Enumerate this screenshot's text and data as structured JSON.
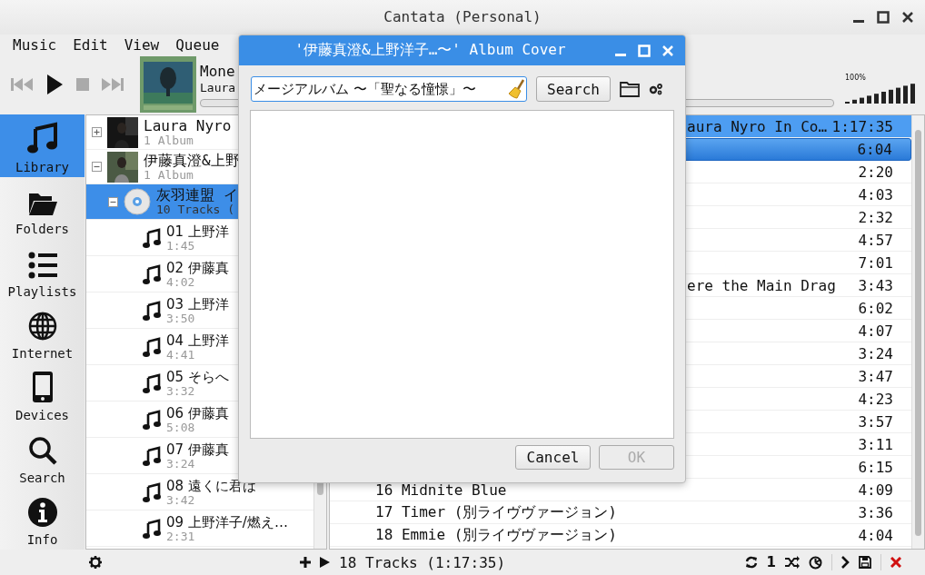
{
  "window": {
    "title": "Cantata (Personal)"
  },
  "menu": [
    "Music",
    "Edit",
    "View",
    "Queue"
  ],
  "now_playing": {
    "title": "Mone",
    "artist": "Laura",
    "volume": "100%"
  },
  "sidebar": [
    {
      "label": "Library",
      "selected": true,
      "kind": "library"
    },
    {
      "label": "Folders",
      "selected": false,
      "kind": "folders"
    },
    {
      "label": "Playlists",
      "selected": false,
      "kind": "playlists"
    },
    {
      "label": "Internet",
      "selected": false,
      "kind": "internet"
    },
    {
      "label": "Devices",
      "selected": false,
      "kind": "devices"
    },
    {
      "label": "Search",
      "selected": false,
      "kind": "search"
    },
    {
      "label": "Info",
      "selected": false,
      "kind": "info"
    }
  ],
  "library": {
    "items": [
      {
        "kind": "artist",
        "name": "Laura Nyro",
        "subtitle": "1 Album",
        "expanded": false,
        "selected": false
      },
      {
        "kind": "artist",
        "name": "伊藤真澄&上野",
        "subtitle": "1 Album",
        "expanded": true,
        "selected": false,
        "children": [
          {
            "kind": "album",
            "name": "灰羽連盟 イ",
            "subtitle": "10 Tracks (",
            "expanded": true,
            "selected": true,
            "children": [
              {
                "kind": "track",
                "name": "01 上野洋",
                "subtitle": "1:45",
                "selected": false
              },
              {
                "kind": "track",
                "name": "02 伊藤真",
                "subtitle": "4:02",
                "selected": false
              },
              {
                "kind": "track",
                "name": "03 上野洋",
                "subtitle": "3:50",
                "selected": false
              },
              {
                "kind": "track",
                "name": "04 上野洋",
                "subtitle": "4:41",
                "selected": false
              },
              {
                "kind": "track",
                "name": "05 そらへ",
                "subtitle": "3:32",
                "selected": false
              },
              {
                "kind": "track",
                "name": "06 伊藤真",
                "subtitle": "5:08",
                "selected": false
              },
              {
                "kind": "track",
                "name": "07 伊藤真",
                "subtitle": "3:24",
                "selected": false
              },
              {
                "kind": "track",
                "name": "08 遠くに君は",
                "subtitle": "3:42",
                "selected": false
              },
              {
                "kind": "track",
                "name": "09 上野洋子/燃え…",
                "subtitle": "2:31",
                "selected": false
              }
            ]
          }
        ]
      }
    ]
  },
  "queue": {
    "rows": [
      {
        "kind": "header",
        "title": "aura Nyro In Co…",
        "duration": "1:17:35",
        "selected": false
      },
      {
        "kind": "partial",
        "duration": "6:04",
        "selected": true
      },
      {
        "kind": "partial",
        "duration": "2:20",
        "selected": false
      },
      {
        "kind": "partial",
        "duration": "4:03",
        "selected": false
      },
      {
        "kind": "partial",
        "duration": "2:32",
        "selected": false
      },
      {
        "kind": "partial",
        "duration": "4:57",
        "selected": false
      },
      {
        "kind": "partial",
        "duration": "7:01",
        "selected": false
      },
      {
        "kind": "partial",
        "title": "ere the Main Drag",
        "duration": "3:43",
        "selected": false
      },
      {
        "kind": "partial",
        "duration": "6:02",
        "selected": false
      },
      {
        "kind": "partial",
        "duration": "4:07",
        "selected": false
      },
      {
        "kind": "partial",
        "duration": "3:24",
        "selected": false
      },
      {
        "kind": "partial",
        "duration": "3:47",
        "selected": false
      },
      {
        "kind": "partial",
        "duration": "4:23",
        "selected": false
      },
      {
        "kind": "partial",
        "duration": "3:57",
        "selected": false
      },
      {
        "kind": "partial",
        "duration": "3:11",
        "selected": false
      },
      {
        "kind": "partial",
        "duration": "6:15",
        "selected": false
      },
      {
        "kind": "track",
        "title": "16 Midnite Blue",
        "duration": "4:09",
        "selected": false
      },
      {
        "kind": "track",
        "title": "17 Timer (別ライヴヴァージョン)",
        "duration": "3:36",
        "selected": false
      },
      {
        "kind": "track",
        "title": "18 Emmie (別ライヴヴァージョン)",
        "duration": "4:04",
        "selected": false
      }
    ]
  },
  "status_bar": {
    "summary": "18 Tracks (1:17:35)",
    "single": "1"
  },
  "dialog": {
    "title": "'伊藤真澄&上野洋子…〜' Album Cover",
    "search_value": "メージアルバム 〜「聖なる憧憬」〜",
    "search_button": "Search",
    "buttons": [
      {
        "label": "Cancel",
        "disabled": false
      },
      {
        "label": "OK",
        "disabled": true
      }
    ]
  }
}
